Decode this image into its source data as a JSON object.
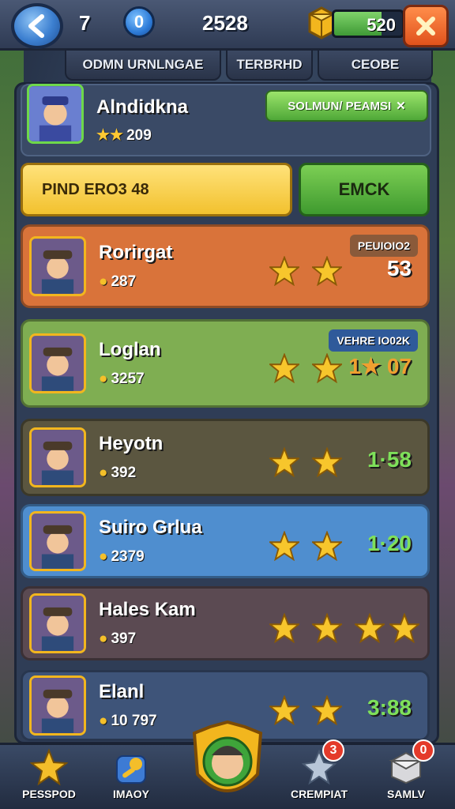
{
  "topbar": {
    "level": "7",
    "coins_badge": "0",
    "score": "2528",
    "gold_value": "520",
    "gold_fill_pct": 70
  },
  "tabs": [
    "ODMN URNLNGAE",
    "TERBRHD",
    "CEOBE"
  ],
  "header": {
    "name": "Alndidkna",
    "stat": "209",
    "action_label": "SOLMUN/ PEAMSI"
  },
  "search_label": "PIND ERO3 48",
  "emok_label": "EMCK",
  "rows": [
    {
      "name": "Rorirgat",
      "stat": "287",
      "badge": "PEUIOIO2",
      "score": "53",
      "bg": "#d9733a",
      "score_color": "#ffffff"
    },
    {
      "name": "Loglan",
      "stat": "3257",
      "badge": "VEHRE IO02K",
      "score": "1★ 07",
      "bg": "#7fae52",
      "score_color": "#f0a030"
    },
    {
      "name": "Heyotn",
      "stat": "392",
      "badge": "",
      "score": "1·58",
      "bg": "#5b5640",
      "score_color": "#7ee05a"
    },
    {
      "name": "Suiro Grlua",
      "stat": "2379",
      "badge": "",
      "score": "1·20",
      "bg": "#4f8ecf",
      "score_color": "#7ee05a"
    },
    {
      "name": "Hales Kam",
      "stat": "397",
      "badge": "",
      "score": "",
      "bg": "#5b4a52",
      "score_color": "#ffffff"
    },
    {
      "name": "Elanl",
      "stat": "10 797",
      "badge": "",
      "score": "3:88",
      "bg": "#3e5479",
      "score_color": "#7ee05a"
    }
  ],
  "nav": [
    {
      "label": "PESSPOD",
      "icon": "star-icon",
      "notif": ""
    },
    {
      "label": "IMAOY",
      "icon": "magic-staff-icon",
      "notif": ""
    },
    {
      "label": "CREMPIAT",
      "icon": "crystal-icon",
      "notif": "3"
    },
    {
      "label": "SAMLV",
      "icon": "box-icon",
      "notif": "0"
    }
  ]
}
